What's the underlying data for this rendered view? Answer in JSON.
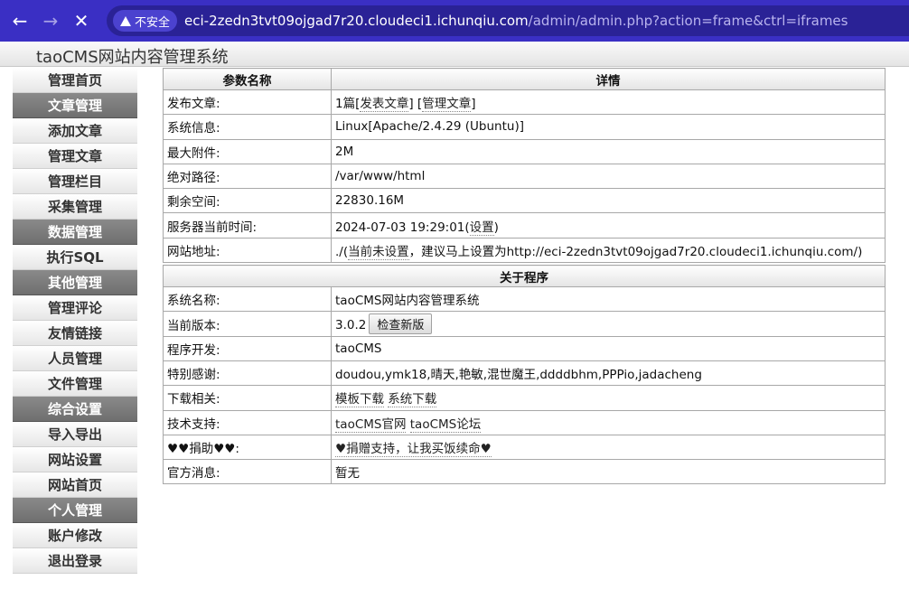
{
  "browser": {
    "insecure_label": "不安全",
    "url_host": "eci-2zedn3tvt09ojgad7r20.cloudeci1.ichunqiu.com",
    "url_path": "/admin/admin.php?action=frame&ctrl=iframes"
  },
  "app": {
    "title": "taoCMS网站内容管理系统"
  },
  "sidebar": {
    "items": [
      {
        "label": "管理首页",
        "type": "link"
      },
      {
        "label": "文章管理",
        "type": "head"
      },
      {
        "label": "添加文章",
        "type": "link"
      },
      {
        "label": "管理文章",
        "type": "link"
      },
      {
        "label": "管理栏目",
        "type": "link"
      },
      {
        "label": "采集管理",
        "type": "link"
      },
      {
        "label": "数据管理",
        "type": "head"
      },
      {
        "label": "执行SQL",
        "type": "link"
      },
      {
        "label": "其他管理",
        "type": "head"
      },
      {
        "label": "管理评论",
        "type": "link"
      },
      {
        "label": "友情链接",
        "type": "link"
      },
      {
        "label": "人员管理",
        "type": "link"
      },
      {
        "label": "文件管理",
        "type": "link"
      },
      {
        "label": "综合设置",
        "type": "head"
      },
      {
        "label": "导入导出",
        "type": "link"
      },
      {
        "label": "网站设置",
        "type": "link"
      },
      {
        "label": "网站首页",
        "type": "link"
      },
      {
        "label": "个人管理",
        "type": "head"
      },
      {
        "label": "账户修改",
        "type": "link"
      },
      {
        "label": "退出登录",
        "type": "link"
      }
    ]
  },
  "info": {
    "col_param": "参数名称",
    "col_detail": "详情",
    "publish": {
      "label": "发布文章:",
      "count": "1篇",
      "post_link": "发表文章",
      "manage_link": "管理文章"
    },
    "sysinfo": {
      "label": "系统信息:",
      "value": "Linux[Apache/2.4.29 (Ubuntu)]"
    },
    "maxattach": {
      "label": "最大附件:",
      "value": "2M"
    },
    "abspath": {
      "label": "绝对路径:",
      "value": "/var/www/html"
    },
    "space": {
      "label": "剩余空间:",
      "value": "22830.16M"
    },
    "servertime": {
      "label": "服务器当前时间:",
      "value": "2024-07-03 19:29:01",
      "set_link": "设置"
    },
    "siteurl": {
      "label": "网站地址:",
      "prefix": "./(",
      "notset": "当前未设置",
      "suffix": "，建议马上设置为http://eci-2zedn3tvt09ojgad7r20.cloudeci1.ichunqiu.com/)"
    }
  },
  "about": {
    "title": "关于程序",
    "sysname": {
      "label": "系统名称:",
      "value": "taoCMS网站内容管理系统"
    },
    "version": {
      "label": "当前版本:",
      "value": "3.0.2",
      "check_button": "检查新版"
    },
    "developer": {
      "label": "程序开发:",
      "value": "taoCMS"
    },
    "thanks": {
      "label": "特别感谢:",
      "value": "doudou,ymk18,晴天,艳敏,混世魔王,ddddbhm,PPPio,jadacheng"
    },
    "downloads": {
      "label": "下载相关:",
      "link1": "模板下载",
      "link2": "系统下载"
    },
    "support": {
      "label": "技术支持:",
      "link1": "taoCMS官网",
      "link2": "taoCMS论坛"
    },
    "donate": {
      "label": "♥♥捐助♥♥:",
      "link": "♥捐赠支持，让我买饭续命♥"
    },
    "news": {
      "label": "官方消息:",
      "value": "暂无"
    }
  }
}
